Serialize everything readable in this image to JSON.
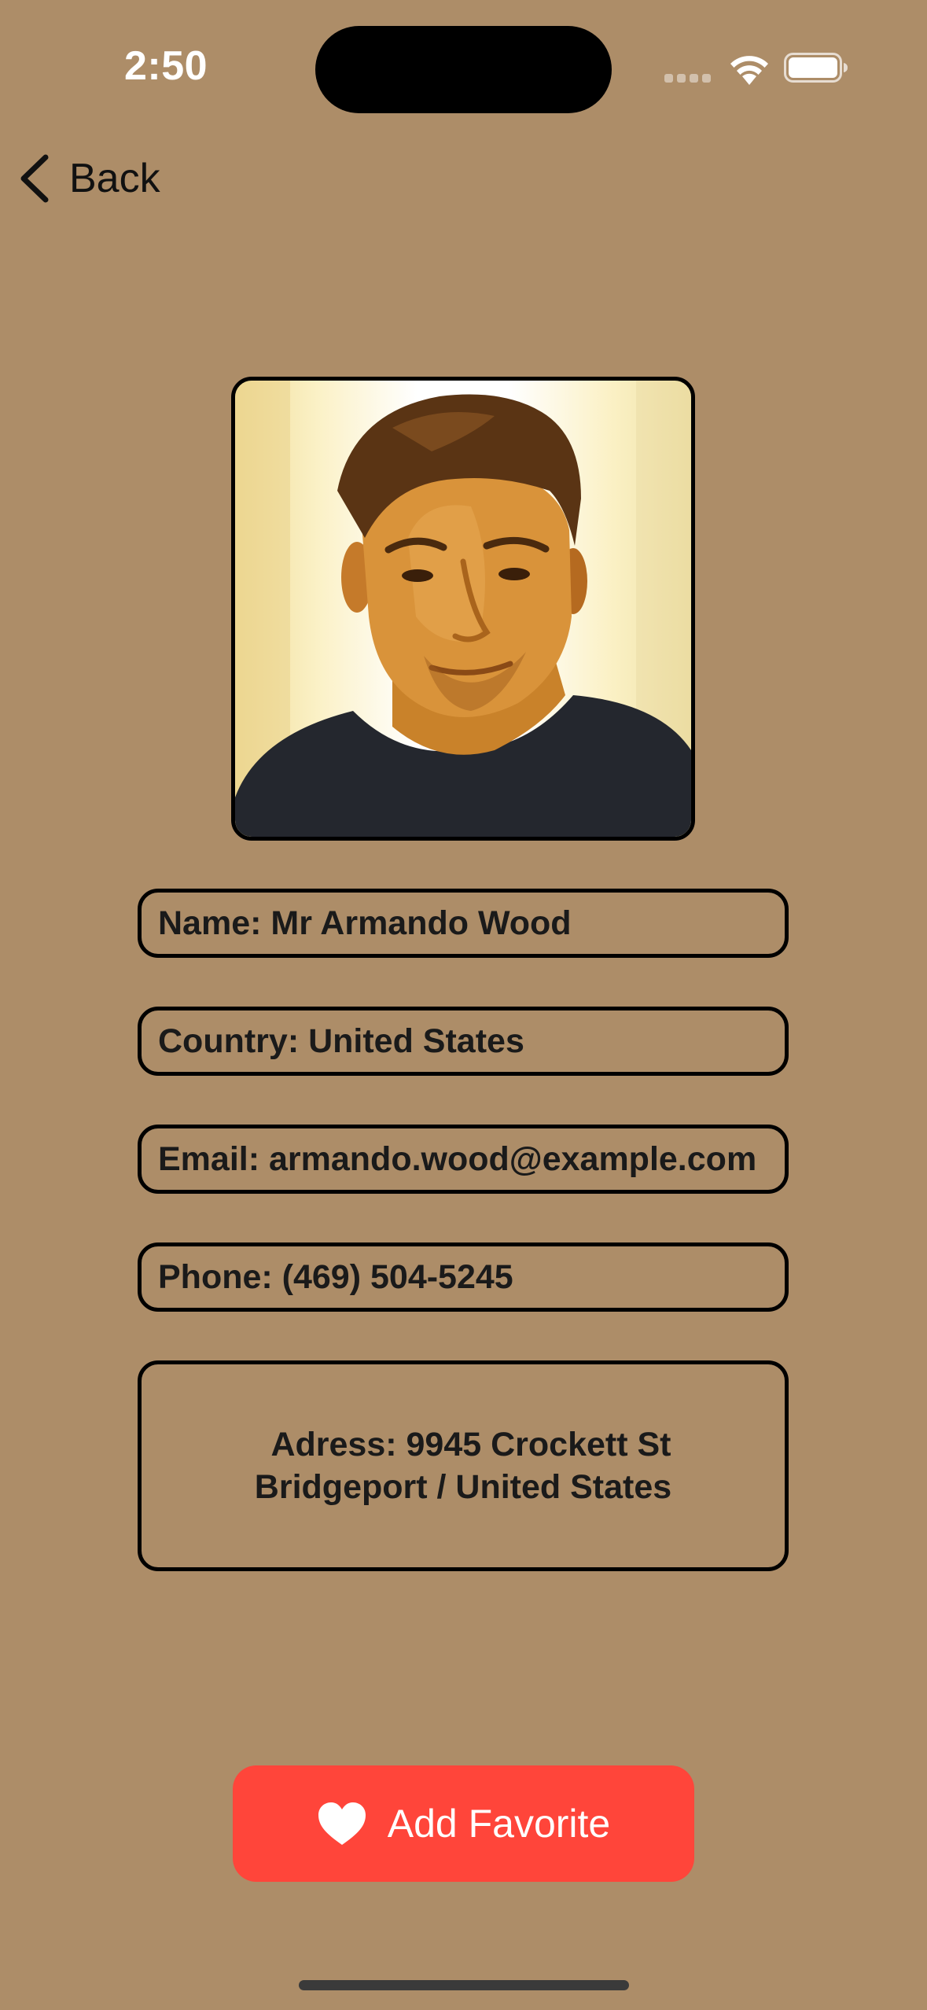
{
  "status_bar": {
    "time": "2:50"
  },
  "nav": {
    "back_label": "Back"
  },
  "profile": {
    "name_field": "Name: Mr Armando Wood",
    "country_field": "Country: United States",
    "email_field": "Email: armando.wood@example.com",
    "phone_field": "Phone: (469) 504-5245",
    "address_line_1": "Adress: 9945 Crockett St",
    "address_line_2": "Bridgeport / United States"
  },
  "actions": {
    "favorite_label": "Add Favorite",
    "favorite_icon": "heart-icon"
  },
  "colors": {
    "background": "#ad8d68",
    "favorite_button": "#ff453a"
  }
}
